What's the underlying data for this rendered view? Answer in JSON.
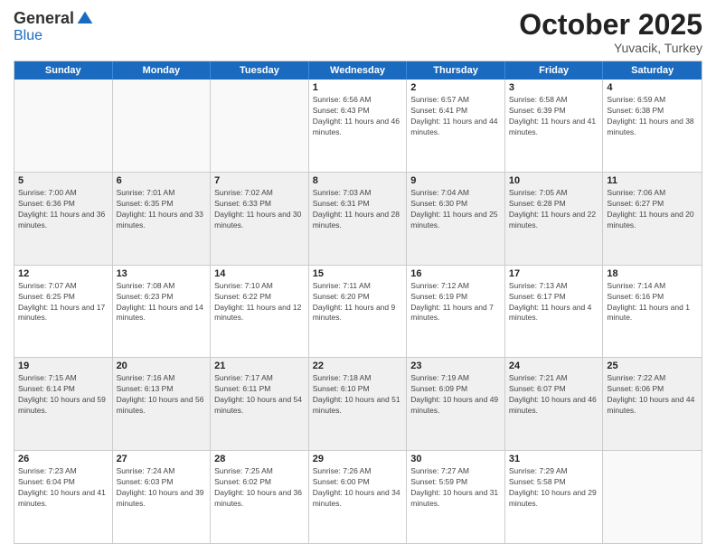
{
  "logo": {
    "general": "General",
    "blue": "Blue"
  },
  "header": {
    "month": "October 2025",
    "location": "Yuvacik, Turkey"
  },
  "weekdays": [
    "Sunday",
    "Monday",
    "Tuesday",
    "Wednesday",
    "Thursday",
    "Friday",
    "Saturday"
  ],
  "rows": [
    [
      {
        "day": "",
        "info": "",
        "empty": true
      },
      {
        "day": "",
        "info": "",
        "empty": true
      },
      {
        "day": "",
        "info": "",
        "empty": true
      },
      {
        "day": "1",
        "info": "Sunrise: 6:56 AM\nSunset: 6:43 PM\nDaylight: 11 hours and 46 minutes."
      },
      {
        "day": "2",
        "info": "Sunrise: 6:57 AM\nSunset: 6:41 PM\nDaylight: 11 hours and 44 minutes."
      },
      {
        "day": "3",
        "info": "Sunrise: 6:58 AM\nSunset: 6:39 PM\nDaylight: 11 hours and 41 minutes."
      },
      {
        "day": "4",
        "info": "Sunrise: 6:59 AM\nSunset: 6:38 PM\nDaylight: 11 hours and 38 minutes."
      }
    ],
    [
      {
        "day": "5",
        "info": "Sunrise: 7:00 AM\nSunset: 6:36 PM\nDaylight: 11 hours and 36 minutes.",
        "shaded": true
      },
      {
        "day": "6",
        "info": "Sunrise: 7:01 AM\nSunset: 6:35 PM\nDaylight: 11 hours and 33 minutes.",
        "shaded": true
      },
      {
        "day": "7",
        "info": "Sunrise: 7:02 AM\nSunset: 6:33 PM\nDaylight: 11 hours and 30 minutes.",
        "shaded": true
      },
      {
        "day": "8",
        "info": "Sunrise: 7:03 AM\nSunset: 6:31 PM\nDaylight: 11 hours and 28 minutes.",
        "shaded": true
      },
      {
        "day": "9",
        "info": "Sunrise: 7:04 AM\nSunset: 6:30 PM\nDaylight: 11 hours and 25 minutes.",
        "shaded": true
      },
      {
        "day": "10",
        "info": "Sunrise: 7:05 AM\nSunset: 6:28 PM\nDaylight: 11 hours and 22 minutes.",
        "shaded": true
      },
      {
        "day": "11",
        "info": "Sunrise: 7:06 AM\nSunset: 6:27 PM\nDaylight: 11 hours and 20 minutes.",
        "shaded": true
      }
    ],
    [
      {
        "day": "12",
        "info": "Sunrise: 7:07 AM\nSunset: 6:25 PM\nDaylight: 11 hours and 17 minutes."
      },
      {
        "day": "13",
        "info": "Sunrise: 7:08 AM\nSunset: 6:23 PM\nDaylight: 11 hours and 14 minutes."
      },
      {
        "day": "14",
        "info": "Sunrise: 7:10 AM\nSunset: 6:22 PM\nDaylight: 11 hours and 12 minutes."
      },
      {
        "day": "15",
        "info": "Sunrise: 7:11 AM\nSunset: 6:20 PM\nDaylight: 11 hours and 9 minutes."
      },
      {
        "day": "16",
        "info": "Sunrise: 7:12 AM\nSunset: 6:19 PM\nDaylight: 11 hours and 7 minutes."
      },
      {
        "day": "17",
        "info": "Sunrise: 7:13 AM\nSunset: 6:17 PM\nDaylight: 11 hours and 4 minutes."
      },
      {
        "day": "18",
        "info": "Sunrise: 7:14 AM\nSunset: 6:16 PM\nDaylight: 11 hours and 1 minute."
      }
    ],
    [
      {
        "day": "19",
        "info": "Sunrise: 7:15 AM\nSunset: 6:14 PM\nDaylight: 10 hours and 59 minutes.",
        "shaded": true
      },
      {
        "day": "20",
        "info": "Sunrise: 7:16 AM\nSunset: 6:13 PM\nDaylight: 10 hours and 56 minutes.",
        "shaded": true
      },
      {
        "day": "21",
        "info": "Sunrise: 7:17 AM\nSunset: 6:11 PM\nDaylight: 10 hours and 54 minutes.",
        "shaded": true
      },
      {
        "day": "22",
        "info": "Sunrise: 7:18 AM\nSunset: 6:10 PM\nDaylight: 10 hours and 51 minutes.",
        "shaded": true
      },
      {
        "day": "23",
        "info": "Sunrise: 7:19 AM\nSunset: 6:09 PM\nDaylight: 10 hours and 49 minutes.",
        "shaded": true
      },
      {
        "day": "24",
        "info": "Sunrise: 7:21 AM\nSunset: 6:07 PM\nDaylight: 10 hours and 46 minutes.",
        "shaded": true
      },
      {
        "day": "25",
        "info": "Sunrise: 7:22 AM\nSunset: 6:06 PM\nDaylight: 10 hours and 44 minutes.",
        "shaded": true
      }
    ],
    [
      {
        "day": "26",
        "info": "Sunrise: 7:23 AM\nSunset: 6:04 PM\nDaylight: 10 hours and 41 minutes."
      },
      {
        "day": "27",
        "info": "Sunrise: 7:24 AM\nSunset: 6:03 PM\nDaylight: 10 hours and 39 minutes."
      },
      {
        "day": "28",
        "info": "Sunrise: 7:25 AM\nSunset: 6:02 PM\nDaylight: 10 hours and 36 minutes."
      },
      {
        "day": "29",
        "info": "Sunrise: 7:26 AM\nSunset: 6:00 PM\nDaylight: 10 hours and 34 minutes."
      },
      {
        "day": "30",
        "info": "Sunrise: 7:27 AM\nSunset: 5:59 PM\nDaylight: 10 hours and 31 minutes."
      },
      {
        "day": "31",
        "info": "Sunrise: 7:29 AM\nSunset: 5:58 PM\nDaylight: 10 hours and 29 minutes."
      },
      {
        "day": "",
        "info": "",
        "empty": true
      }
    ]
  ]
}
